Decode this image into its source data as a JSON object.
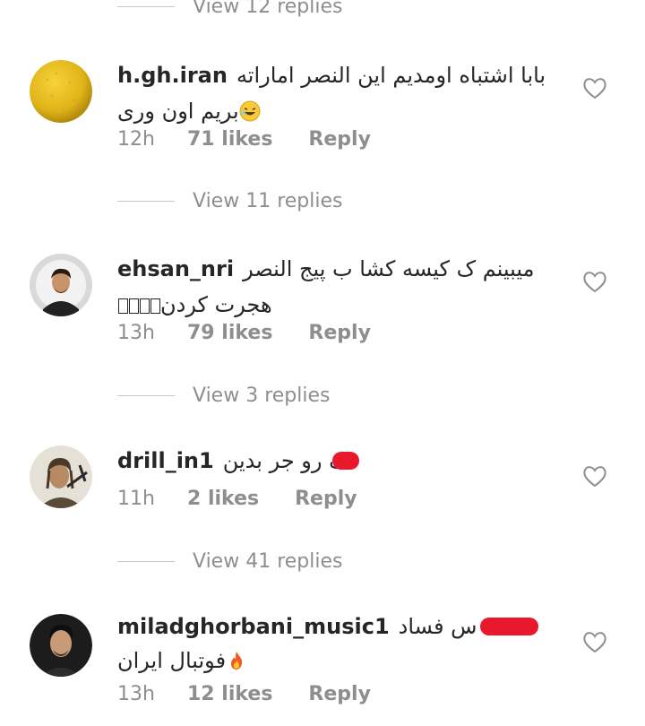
{
  "view_replies": [
    "View 12 replies",
    "View 11 replies",
    "View 3 replies",
    "View 41 replies"
  ],
  "comments": [
    {
      "username": "h.gh.iran",
      "text_line1": "بابا اشتباه اومدیم این النصر اماراته",
      "text_line2": "بریم اون وری",
      "time": "12h",
      "likes": "71 likes",
      "reply": "Reply",
      "avatar": "yellow-ball-avatar"
    },
    {
      "username": "ehsan_nri",
      "text_line1": "میبینم ک کیسه کشا ب پیج النصر",
      "text_line2": "هجرت کردن",
      "time": "13h",
      "likes": "79 likes",
      "reply": "Reply",
      "avatar": "man-portrait-avatar"
    },
    {
      "username": "drill_in1",
      "text_line1": "ک رو جر بدین",
      "time": "11h",
      "likes": "2 likes",
      "reply": "Reply",
      "avatar": "man-with-crossbow-avatar"
    },
    {
      "username": "miladghorbani_music1",
      "text_line1": "س فساد",
      "text_line2": "فوتبال ایران",
      "time": "13h",
      "likes": "12 likes",
      "reply": "Reply",
      "avatar": "man-dark-portrait-avatar"
    }
  ],
  "icons": {
    "like": "heart-outline-icon",
    "emoji1": "laughing-face-emoji",
    "emoji2": "fire-emoji"
  },
  "colors": {
    "text": "#262626",
    "secondary": "#8e8e8e",
    "redaction": "#e8192c"
  }
}
